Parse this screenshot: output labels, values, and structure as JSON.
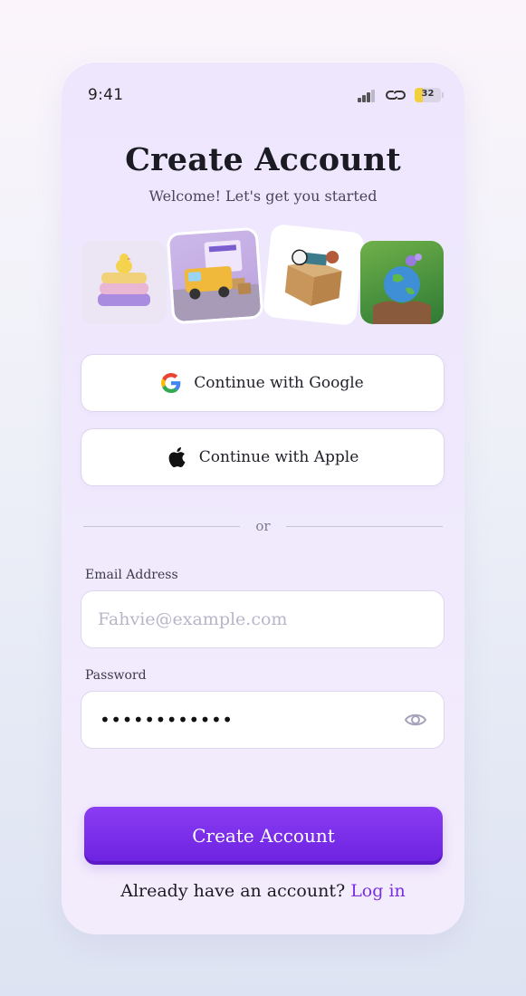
{
  "status_bar": {
    "time": "9:41",
    "battery": "32"
  },
  "header": {
    "title": "Create Account",
    "subtitle": "Welcome! Let's get you started"
  },
  "thumbnails": [
    "clothes-stack-thumbnail",
    "delivery-truck-thumbnail",
    "moving-box-thumbnail",
    "earth-hands-thumbnail"
  ],
  "social": {
    "google_label": "Continue with Google",
    "apple_label": "Continue with Apple"
  },
  "divider": {
    "text": "or"
  },
  "form": {
    "email_label": "Email Address",
    "email_placeholder": "Fahvie@example.com",
    "email_value": "",
    "password_label": "Password",
    "password_masked": "••••••••••••"
  },
  "actions": {
    "create_label": "Create Account"
  },
  "footer": {
    "prompt": "Already have an account?",
    "login_label": "Log in"
  },
  "colors": {
    "accent": "#7a2fe0",
    "button": "#6c22e0",
    "background": "#ede6fd"
  }
}
